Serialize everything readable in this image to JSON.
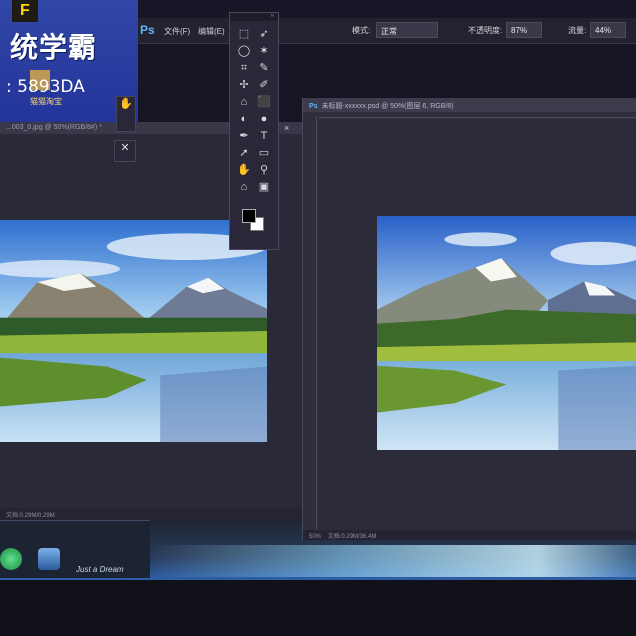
{
  "brand": {
    "logo_letter": "F",
    "title": "统学霸",
    "id_text": ": 5893DA",
    "sub": "猫猫淘宝"
  },
  "options_bar": {
    "app_badge": "Ps",
    "menu": [
      "文件(F)",
      "编辑(E)"
    ],
    "mode_label": "模式:",
    "mode_value": "正常",
    "opacity_label": "不透明度:",
    "opacity_value": "87%",
    "flow_label": "流量:",
    "flow_value": "44%"
  },
  "left_document": {
    "tab_title": "...003_0.jpg @ 50%(RGB/8#) *",
    "status": "文档:0.29M/0.29M",
    "close": "×"
  },
  "right_document": {
    "app_badge": "Ps",
    "tab_title": "未标题-xxxxxx.psd @ 50%(图层 6, RGB/8)",
    "zoom": "50%",
    "status": "文档:0.29M/36.4M"
  },
  "tools_panel": {
    "tools": [
      "⬚",
      "➶",
      "◯",
      "✶",
      "⌗",
      "✎",
      "✢",
      "✐",
      "⌂",
      "⬛",
      "◐",
      "●",
      "✒",
      "T",
      "➚",
      "▭",
      "✋",
      "⚲",
      "⌂",
      "▣"
    ]
  },
  "desktop": {
    "note": "Just a Dream"
  },
  "colors": {
    "ps_blue": "#5db7ff",
    "brand_blue": "#23349a",
    "brand_yellow": "#ffd400",
    "panel_bg": "#2a2838"
  }
}
